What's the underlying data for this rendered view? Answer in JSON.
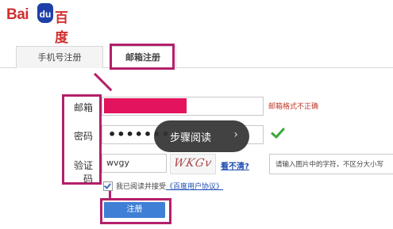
{
  "logo": {
    "bai": "Bai",
    "du": "du",
    "baidu_cn": "百度"
  },
  "tabs": [
    {
      "label": "手机号注册"
    },
    {
      "label": "邮箱注册"
    }
  ],
  "form": {
    "email_label": "邮箱",
    "email_error": "邮箱格式不正确",
    "password_label": "密码",
    "password_value": "•••••••",
    "code_label": "验证码",
    "code_value": "wvgy",
    "captcha_text": "WKGv",
    "cant_see": "看不清?",
    "code_hint": "请输入图片中的字符，不区分大小写",
    "agree_prefix": "我已阅读并接受",
    "agree_link": "《百度用户协议》",
    "register_label": "注册"
  },
  "overlay": {
    "text": "步骤阅读",
    "chevron": "›"
  },
  "icons": {
    "valid": "check-icon",
    "agree": "checkbox-checked-icon"
  },
  "colors": {
    "highlight": "#b3206a",
    "brand_red": "#d32f2f",
    "brand_blue": "#1e3fa8",
    "button": "#3f7fd6"
  }
}
